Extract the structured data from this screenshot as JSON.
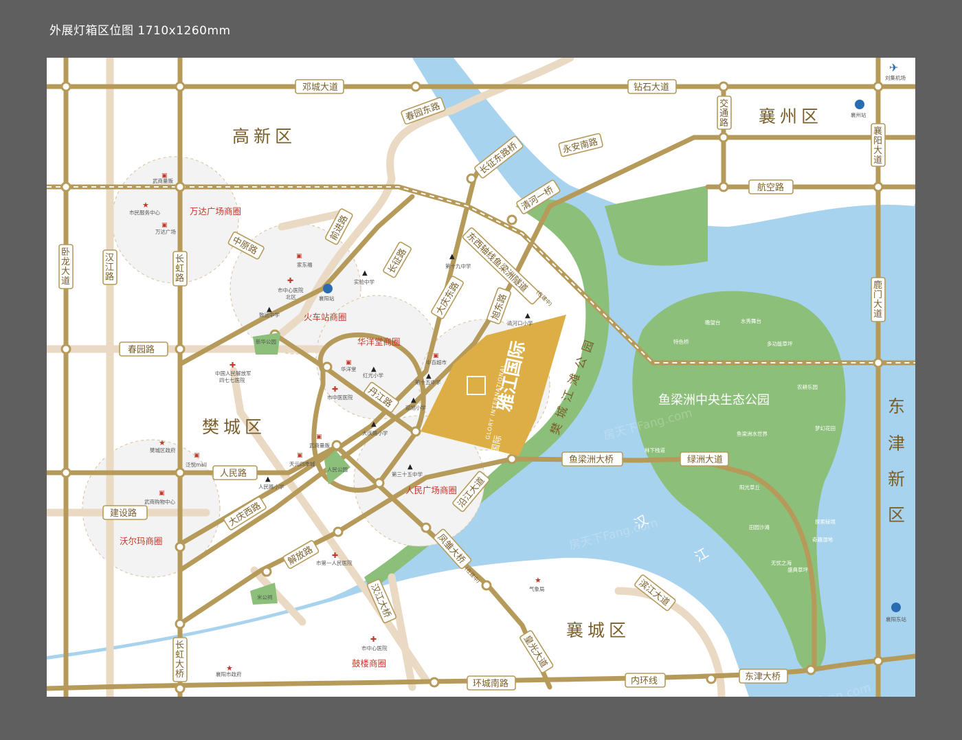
{
  "header": "外展灯箱区位图 1710x1260mm",
  "colors": {
    "road": "#b69a5a",
    "road_label": "#7a5f2a",
    "minor_road": "#ead9c3",
    "water": "#a8d3ee",
    "park": "#8cbf7a",
    "project": "#dcae45",
    "zone_text": "#c0392b",
    "background": "#5f5f5f"
  },
  "districts": {
    "gaoxin": "高新区",
    "xiangzhou": "襄州区",
    "fancheng": "樊城区",
    "xiangcheng": "襄城区",
    "dongjin_1": "东",
    "dongjin_2": "津",
    "dongjin_3": "新",
    "dongjin_4": "区"
  },
  "roads": {
    "dengcheng": "邓城大道",
    "zuanshi": "钻石大道",
    "chunyuan_east": "春园东路",
    "yongan": "永安南路",
    "changzheng_bridge": "长征东路桥",
    "jiaotong_1": "交",
    "jiaotong_2": "通",
    "jiaotong_3": "路",
    "xiangyang_1": "襄",
    "xiangyang_2": "阳",
    "xiangyang_3": "大",
    "xiangyang_4": "道",
    "hangkong": "航空路",
    "qinghe_bridge": "清河一桥",
    "tunnel": "东西轴线鱼梁洲隧道",
    "tunnel_note": "(在建中)",
    "wolong_1": "卧",
    "wolong_2": "龙",
    "wolong_3": "大",
    "wolong_4": "道",
    "hanjiang_1": "汉",
    "hanjiang_2": "江",
    "hanjiang_3": "路",
    "changhong_1": "长",
    "changhong_2": "虹",
    "changhong_3": "路",
    "zhongyuan": "中原路",
    "qiancheng": "前进路",
    "changzheng": "长征路",
    "daqing_east": "大庆东路",
    "xudong": "旭东路",
    "chunyuan": "春园路",
    "danjiang": "丹江路",
    "renmin": "人民路",
    "jianshe": "建设路",
    "daqing_west": "大庆西路",
    "jiefang": "解放路",
    "yanjiang": "沿江大道",
    "fengxiong": "凤雏大桥",
    "fengxiong_note": "(在建中)",
    "hanjiang_bridge": "汉江大桥",
    "changhong_bridge_1": "长",
    "changhong_bridge_2": "虹",
    "changhong_bridge_3": "大",
    "changhong_bridge_4": "桥",
    "huangguang": "皇光大道",
    "binjiang": "滨江大道",
    "huancheng_south": "环城南路",
    "neihuan": "内环线",
    "dongjin_bridge": "东津大桥",
    "yuliangzhou_bridge": "鱼梁洲大桥",
    "lvzhou": "绿洲大道",
    "lumen_1": "鹿",
    "lumen_2": "门",
    "lumen_3": "大",
    "lumen_4": "道",
    "fanchengjiangtan_1": "樊",
    "fanchengjiangtan_2": "城",
    "fanchengjiangtan_3": "江",
    "fanchengjiangtan_4": "滩",
    "fanchengjiangtan_5": "公",
    "fanchengjiangtan_6": "园"
  },
  "zones": {
    "wanda": "万达广场商圈",
    "huochezhan": "火车站商圈",
    "huayangtang": "华洋堂商圈",
    "renmin_sq": "人民广场商圈",
    "walmart": "沃尔玛商圈",
    "gulou": "鼓楼商圈"
  },
  "pois": {
    "wushang_liangfan": "武商量贩",
    "citizen_center": "市民服务中心",
    "wanda_plaza": "万达广场",
    "jiadong": "家东福",
    "hospital_north_1": "市中心医院",
    "hospital_north_2": "北区",
    "xiangyang_station": "襄阳站",
    "shiyan_school": "实验中学",
    "zhiyuan_school": "致远中学",
    "xinhua_park": "新华公园",
    "pla_hospital_1": "中国人民解放军",
    "pla_hospital_2": "四七七医院",
    "school_19": "第十九中学",
    "qinghekou": "清河口小学",
    "huayangtang": "华洋堂",
    "hongguang": "红光小学",
    "zhongbai": "中百超市",
    "school_15": "第十五中学",
    "tcm_hospital": "市中医医院",
    "yingxu": "迎旭小学",
    "daqinglu_school": "大庆路小学",
    "wushang_liangfan_2": "武商量贩",
    "tianyuan": "天元四季城",
    "renmin_park": "人民公园",
    "school_35": "第三十五中学",
    "fancheng_gov": "樊城区政府",
    "fanyue": "泛悦mall",
    "renminlu_school": "人民路小学",
    "wushang_mall": "武商购物中心",
    "no1_hospital": "市第一人民医院",
    "mi_park": "米公祠",
    "weather": "气象局",
    "hospital_center": "市中心医院",
    "city_gov": "襄阳市政府",
    "liuji_airport": "刘集机场",
    "xiangzhou_station": "襄州站",
    "xiangyang_east": "襄阳东站"
  },
  "park": {
    "title": "鱼梁洲中央生态公园",
    "guanjingtai": "瞻望台",
    "shuixiu": "水秀舞台",
    "tese": "特色桥",
    "duogongneng": "多功能草坪",
    "nonggeng": "农耕乐园",
    "mengjuan": "梦幻花田",
    "shuishijie": "鱼梁洲水世界",
    "linxia": "林下栈道",
    "yangguang": "阳光草丘",
    "tianyuan": "田园沙滩",
    "tanxian": "探索秘境",
    "qiqu": "奇趣湿地",
    "wuyou": "无忧之海",
    "shengdian": "盛典草坪"
  },
  "river_label": {
    "a": "汉",
    "b": "江"
  },
  "project": {
    "name": "雅江国际",
    "english": "GLORY INTERNATIONAL",
    "developer": "国际"
  },
  "watermark": "房天下Fang.com"
}
